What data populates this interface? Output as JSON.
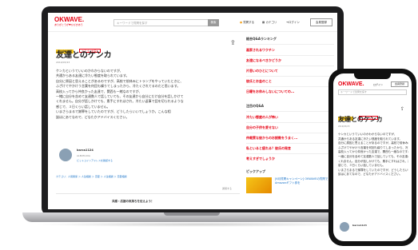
{
  "site": {
    "logo": "OKWAVE.",
    "tagline": "ありがとうが♥ひびきあう",
    "search_placeholder": "キーワードで質問を探す",
    "search_button": "検索",
    "nav": {
      "ask": "質問する",
      "category": "カテゴリ",
      "login": "ログイン",
      "register": "会員登録"
    }
  },
  "question": {
    "badges": [
      "受付中の質問",
      "カテゴリを探す"
    ],
    "title": "友達とのケンカ",
    "date": "2019/03/23",
    "body": [
      "ケンカというていいのかわからないのですが、",
      "共通からある友達に冷たい態度を取られています。",
      "自分に原因と思えることがあるのですが、高校で前休みにトランプをやっていたときに、",
      "ふざけてやかけう言葉を何回も繰りてしまったから、冷たくされてるのだと思います。",
      "高校入ってから仲良かった友達で、関西も一緒なのですが、",
      "一緒に自分を含めて友達数人で話していても、その友達から自分にだけ自分を話しかけて",
      "くれません。自分が話しかけても、素手にすれはされ、冷たい返事で話を切られるような",
      "感じで、３日くらい話していません。",
      "いまさらまるで謝罪をしていたのですが、どうしたらいいでしょうか。こんな相",
      "談はにあてなので、どなたかアドバイスください。"
    ],
    "user": {
      "name": "barca1124",
      "meta": "ALBUM-DIA",
      "link": "ビットコインアドレスを確認する"
    },
    "tags": "カテゴリ：人間関係 ＞ 人生相談 ＞ 恋愛 ＞ 人生相談 ＞ 恋愛相談",
    "report": "通報する",
    "footer_banner": "共感・応援の気持ちを伝えよう！"
  },
  "sidebar": {
    "ranking_title": "総合Q&Aランキング",
    "ranking": [
      "画家されるワクチン",
      "友達になるべきかどうか",
      "片思いのひとについて",
      "彼氏とお金のこと",
      "日曜をお休みしないについての..."
    ],
    "popular_title": "注目のQ&A",
    "popular": [
      "冷たい態度の人が怖い",
      "自分の子供を愛せない",
      "仲裁質な彼からのお説教をうまく...",
      "私といると疲れる？彼氏の発言",
      "考えすぎでしょうか"
    ],
    "pickup_title": "ピックアップ",
    "pickup_text": "[6月質問キャンペーン] OKWAVEの質問でAmazonギフト券を"
  },
  "phone": {
    "login": "ログイン",
    "register": "会員登録",
    "user": "barca1124"
  },
  "colors": {
    "brand": "#e60012",
    "badge_yellow": "#f5c518",
    "link": "#1a73c8"
  }
}
